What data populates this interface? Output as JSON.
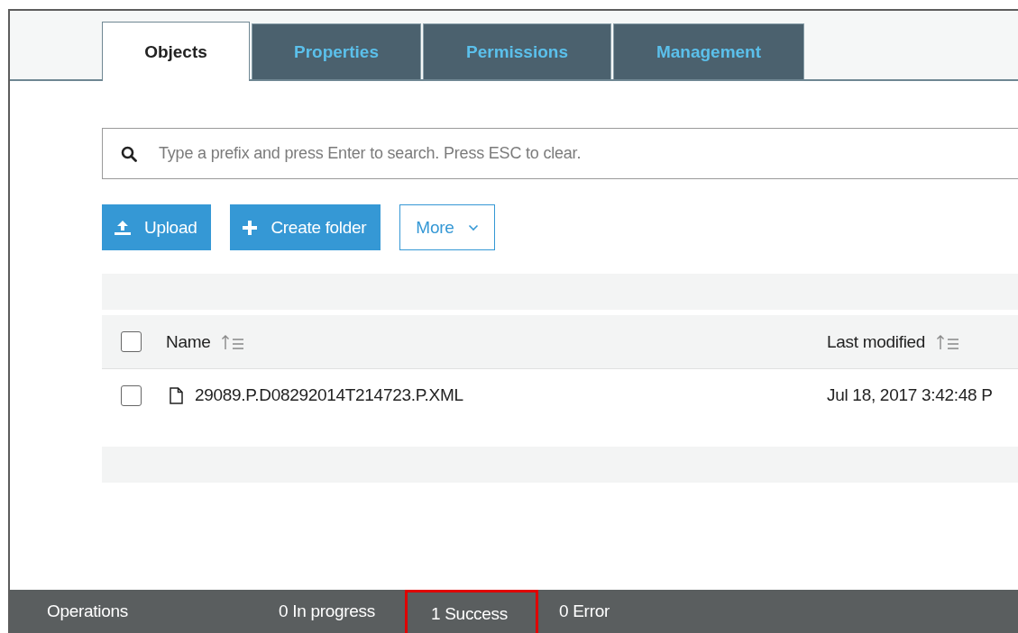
{
  "tabs": [
    {
      "label": "Objects",
      "selected": true
    },
    {
      "label": "Properties",
      "selected": false
    },
    {
      "label": "Permissions",
      "selected": false
    },
    {
      "label": "Management",
      "selected": false
    }
  ],
  "search": {
    "placeholder": "Type a prefix and press Enter to search. Press ESC to clear."
  },
  "buttons": [
    {
      "label": "Upload",
      "kind": "upload"
    },
    {
      "label": "Create folder",
      "kind": "create"
    },
    {
      "label": "More",
      "kind": "dropdown"
    }
  ],
  "table": {
    "select_all": {
      "checked": false
    },
    "columns": [
      {
        "label": "Name"
      },
      {
        "label": "Last modified"
      }
    ],
    "rows": [
      {
        "checked": false,
        "name": "29089.P.D08292014T214723.P.XML",
        "last_modified": "Jul 18, 2017 3:42:48 P"
      }
    ]
  },
  "status_bar": {
    "title": "Operations",
    "items": [
      {
        "label": "0 In progress",
        "highlighted": false
      },
      {
        "label": "1 Success",
        "highlighted": true
      },
      {
        "label": "0 Error",
        "highlighted": false
      }
    ]
  }
}
